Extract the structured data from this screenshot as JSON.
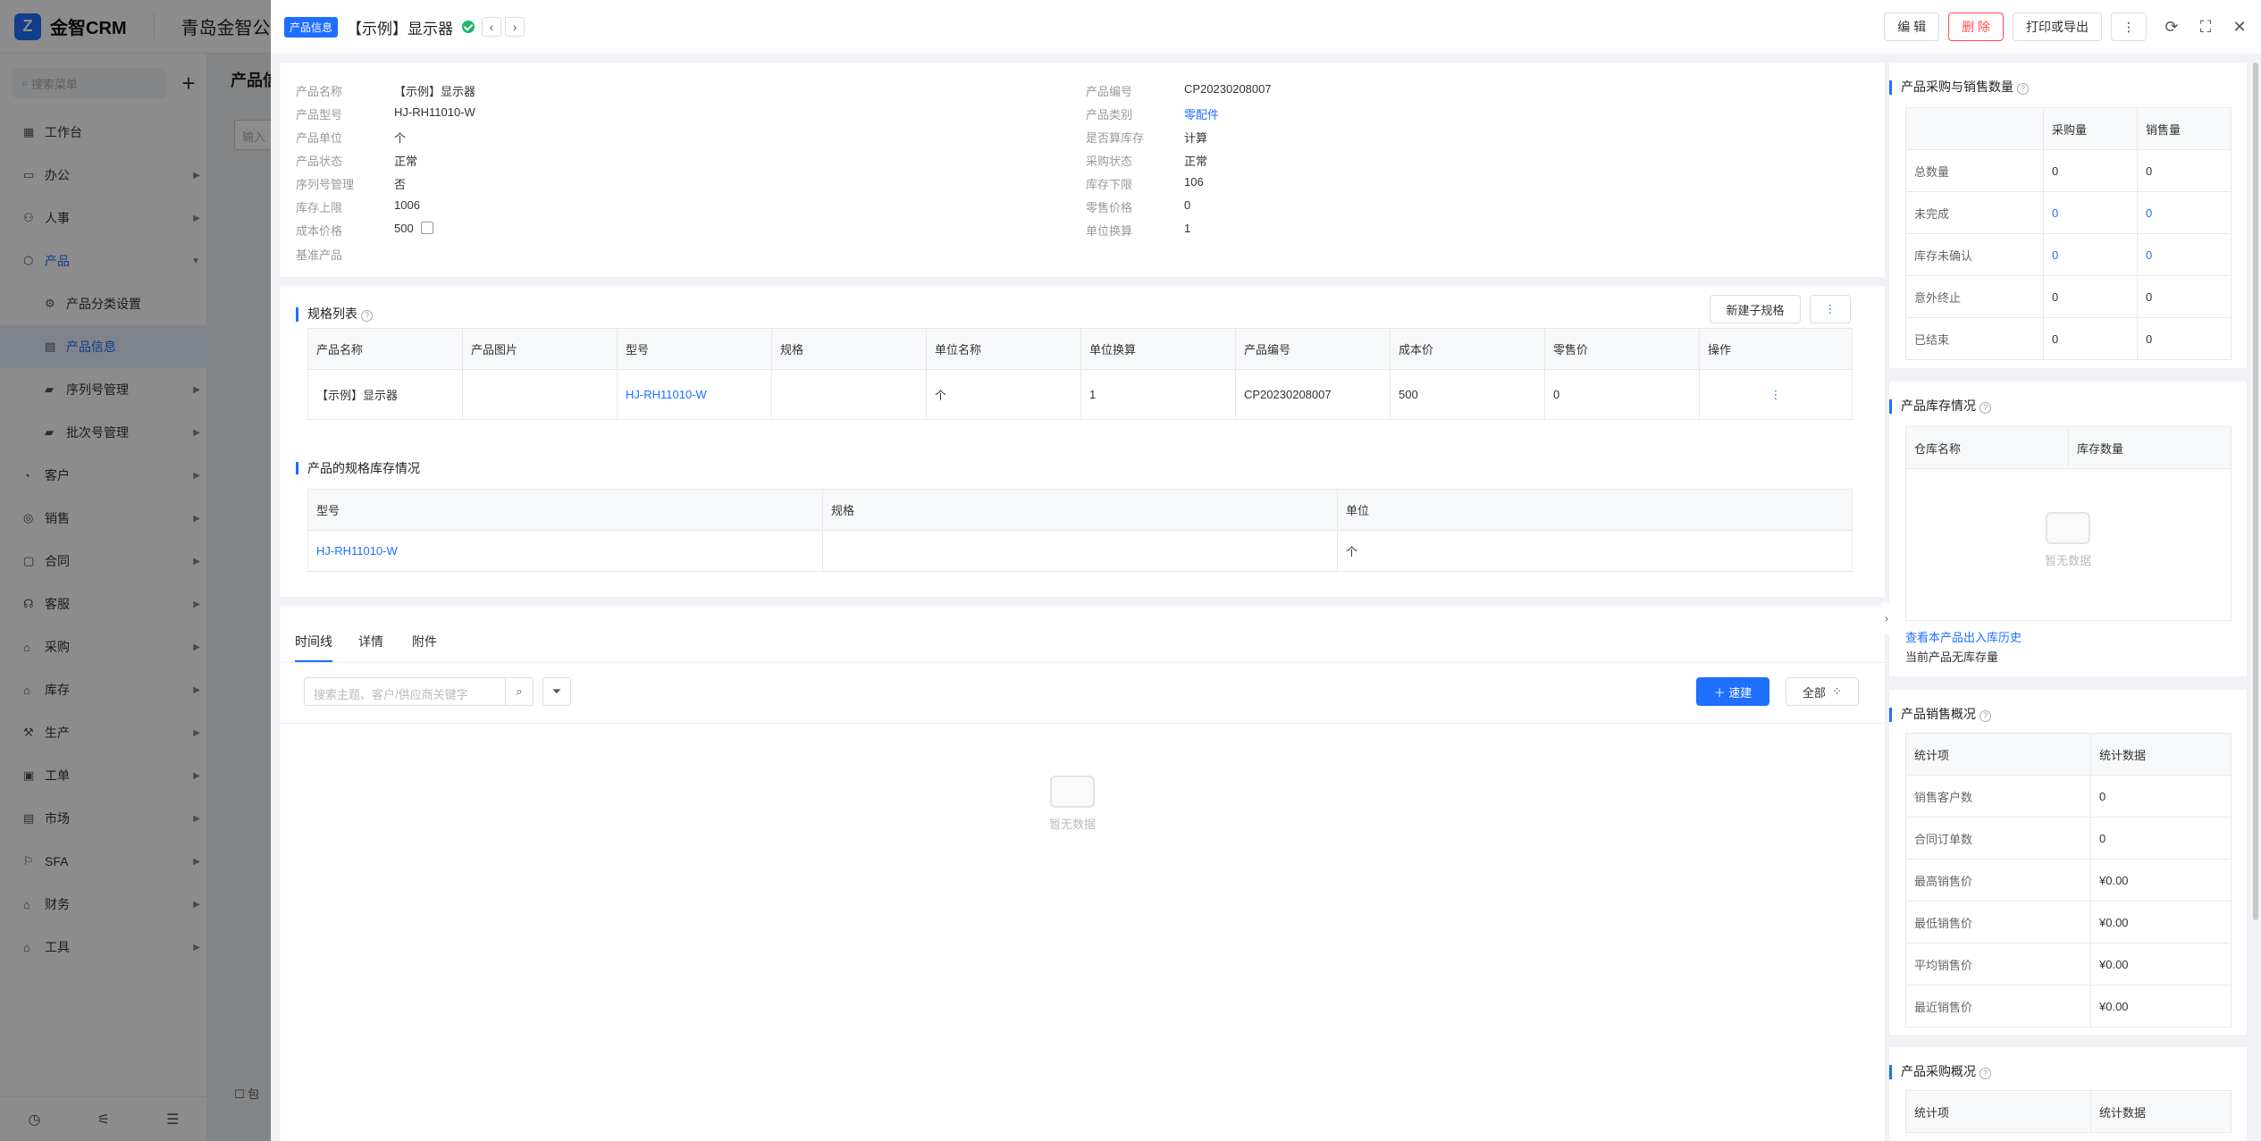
{
  "app": {
    "logo_text": "金智CRM",
    "company": "青岛金智公司",
    "search_placeholder": "搜索菜单",
    "bg_title": "产品信",
    "bg_input": "输入",
    "bg_check": "包"
  },
  "sidebar": {
    "items": [
      {
        "label": "工作台",
        "icon": "dashboard-icon"
      },
      {
        "label": "办公",
        "icon": "office-icon"
      },
      {
        "label": "人事",
        "icon": "people-icon"
      },
      {
        "label": "产品",
        "icon": "product-icon"
      },
      {
        "label": "产品分类设置",
        "icon": "gear-icon"
      },
      {
        "label": "产品信息",
        "icon": "doc-icon"
      },
      {
        "label": "序列号管理",
        "icon": "folder-icon"
      },
      {
        "label": "批次号管理",
        "icon": "folder-icon"
      },
      {
        "label": "客户",
        "icon": "customer-icon"
      },
      {
        "label": "销售",
        "icon": "sales-icon"
      },
      {
        "label": "合同",
        "icon": "contract-icon"
      },
      {
        "label": "客服",
        "icon": "service-icon"
      },
      {
        "label": "采购",
        "icon": "purchase-icon"
      },
      {
        "label": "库存",
        "icon": "warehouse-icon"
      },
      {
        "label": "生产",
        "icon": "factory-icon"
      },
      {
        "label": "工单",
        "icon": "ticket-icon"
      },
      {
        "label": "市场",
        "icon": "market-icon"
      },
      {
        "label": "SFA",
        "icon": "sfa-icon"
      },
      {
        "label": "财务",
        "icon": "finance-icon"
      },
      {
        "label": "工具",
        "icon": "tool-icon"
      }
    ]
  },
  "drawer": {
    "tag": "产品信息",
    "title": "【示例】显示器",
    "actions": {
      "edit": "编 辑",
      "delete": "删 除",
      "print": "打印或导出"
    }
  },
  "info": {
    "left": [
      {
        "k": "产品名称",
        "v": "【示例】显示器"
      },
      {
        "k": "产品型号",
        "v": "HJ-RH11010-W"
      },
      {
        "k": "产品单位",
        "v": "个"
      },
      {
        "k": "产品状态",
        "v": "正常"
      },
      {
        "k": "序列号管理",
        "v": "否"
      },
      {
        "k": "库存上限",
        "v": "1006"
      },
      {
        "k": "成本价格",
        "v": "500"
      },
      {
        "k": "基准产品",
        "v": ""
      }
    ],
    "right": [
      {
        "k": "产品编号",
        "v": "CP20230208007"
      },
      {
        "k": "产品类别",
        "v": "零配件"
      },
      {
        "k": "是否算库存",
        "v": "计算"
      },
      {
        "k": "采购状态",
        "v": "正常"
      },
      {
        "k": "库存下限",
        "v": "106"
      },
      {
        "k": "零售价格",
        "v": "0"
      },
      {
        "k": "单位换算",
        "v": "1"
      }
    ]
  },
  "spec": {
    "title": "规格列表",
    "new_button": "新建子规格",
    "headers": [
      "产品名称",
      "产品图片",
      "型号",
      "规格",
      "单位名称",
      "单位换算",
      "产品编号",
      "成本价",
      "零售价",
      "操作"
    ],
    "rows": [
      [
        "【示例】显示器",
        "",
        "HJ-RH11010-W",
        "",
        "个",
        "1",
        "CP20230208007",
        "500",
        "0",
        "⋮"
      ]
    ]
  },
  "stock": {
    "title": "产品的规格库存情况",
    "headers": [
      "型号",
      "规格",
      "单位"
    ],
    "rows": [
      [
        "HJ-RH11010-W",
        "",
        "个"
      ]
    ]
  },
  "timeline": {
    "tabs": [
      "时间线",
      "详情",
      "附件"
    ],
    "search_placeholder": "搜索主题、客户/供应商关键字",
    "new_button": "速建",
    "all_button": "全部",
    "empty": "暂无数据"
  },
  "right": {
    "purchase_sales": {
      "title": "产品采购与销售数量",
      "headers": [
        "",
        "采购量",
        "销售量"
      ],
      "rows": [
        [
          "总数量",
          "0",
          "0"
        ],
        [
          "未完成",
          "0",
          "0"
        ],
        [
          "库存未确认",
          "0",
          "0"
        ],
        [
          "意外终止",
          "0",
          "0"
        ],
        [
          "已结束",
          "0",
          "0"
        ]
      ]
    },
    "inventory": {
      "title": "产品库存情况",
      "headers": [
        "仓库名称",
        "库存数量"
      ],
      "empty": "暂无数据",
      "history_link": "查看本产品出入库历史",
      "note": "当前产品无库存量"
    },
    "sales_overview": {
      "title": "产品销售概况",
      "headers": [
        "统计项",
        "统计数据"
      ],
      "rows": [
        [
          "销售客户数",
          "0"
        ],
        [
          "合同订单数",
          "0"
        ],
        [
          "最高销售价",
          "¥0.00"
        ],
        [
          "最低销售价",
          "¥0.00"
        ],
        [
          "平均销售价",
          "¥0.00"
        ],
        [
          "最近销售价",
          "¥0.00"
        ]
      ]
    },
    "purchase_overview": {
      "title": "产品采购概况",
      "headers": [
        "统计项",
        "统计数据"
      ]
    }
  }
}
